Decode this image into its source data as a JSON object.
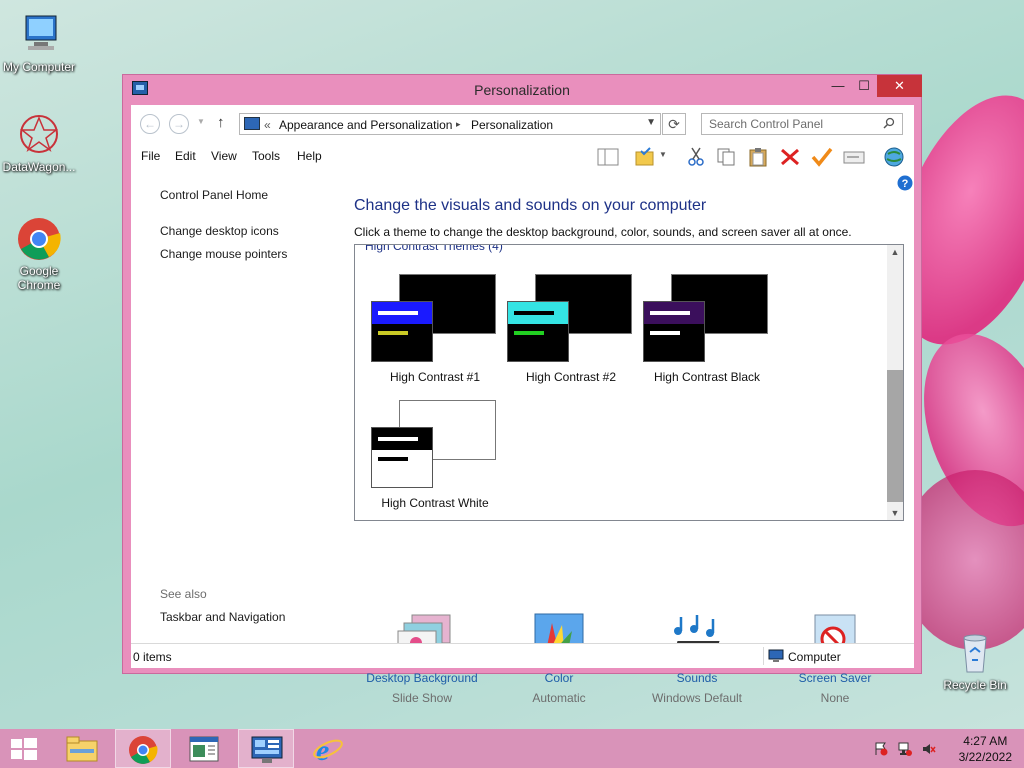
{
  "desktop": {
    "icons": [
      {
        "label": "My Computer"
      },
      {
        "label": "DataWagon..."
      },
      {
        "label": "Google Chrome"
      },
      {
        "label": "Recycle Bin"
      }
    ]
  },
  "window": {
    "title": "Personalization",
    "controls": {
      "minimize": "—",
      "maximize": "☐",
      "close": "✕"
    }
  },
  "address": {
    "back": "←",
    "forward": "→",
    "up": "↑",
    "chevron": "«",
    "crumbs": [
      "Appearance and Personalization",
      "Personalization"
    ],
    "separator": "▸",
    "refresh": "⟳",
    "search_placeholder": "Search Control Panel"
  },
  "menu": [
    "File",
    "Edit",
    "View",
    "Tools",
    "Help"
  ],
  "left_pane": {
    "home": "Control Panel Home",
    "links": [
      "Change desktop icons",
      "Change mouse pointers"
    ],
    "see_also_title": "See also",
    "see_also": [
      "Taskbar and Navigation"
    ]
  },
  "main": {
    "heading": "Change the visuals and sounds on your computer",
    "subtitle": "Click a theme to change the desktop background, color, sounds, and screen saver all at once.",
    "group_header": "High Contrast Themes (4)",
    "themes": [
      {
        "label": "High Contrast #1",
        "back": "#000000",
        "front": "#000000",
        "title": "#1a1aff",
        "accent": "#c9c925"
      },
      {
        "label": "High Contrast #2",
        "back": "#000000",
        "front": "#000000",
        "title": "#34e4e4",
        "accent": "#22d022"
      },
      {
        "label": "High Contrast Black",
        "back": "#000000",
        "front": "#000000",
        "title": "#3b0f5c",
        "accent": "#ffffff"
      },
      {
        "label": "High Contrast White",
        "back": "#ffffff",
        "front": "#ffffff",
        "title": "#000000",
        "accent": "#000000"
      }
    ]
  },
  "options": [
    {
      "name": "Desktop Background",
      "value": "Slide Show"
    },
    {
      "name": "Color",
      "value": "Automatic"
    },
    {
      "name": "Sounds",
      "value": "Windows Default"
    },
    {
      "name": "Screen Saver",
      "value": "None"
    }
  ],
  "status": {
    "items": "0 items",
    "location": "Computer"
  },
  "taskbar": {
    "time": "4:27 AM",
    "date": "3/22/2022"
  },
  "colors": {
    "window_frame": "#e98fbd",
    "close_button": "#c7333a",
    "link": "#1e5da8",
    "heading": "#1e3287",
    "taskbar": "#d993b9"
  }
}
